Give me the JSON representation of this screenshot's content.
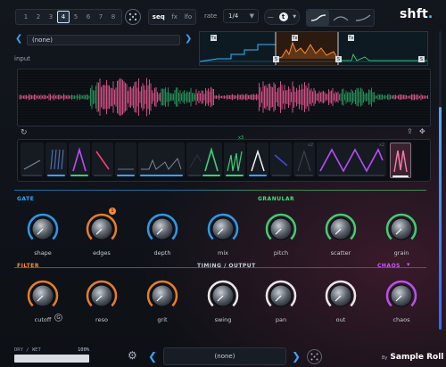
{
  "header": {
    "slots": [
      "1",
      "2",
      "3",
      "4",
      "5",
      "6",
      "7",
      "8"
    ],
    "active_slot": 3,
    "tabs": [
      {
        "label": "seq",
        "selected": true
      },
      {
        "label": "fx",
        "selected": false
      },
      {
        "label": "lfo",
        "selected": false
      }
    ],
    "rate_label": "rate",
    "rate_value": "1/4",
    "trigger_badge": "t",
    "logo_text": "shft",
    "logo_dot": "."
  },
  "preset_top": {
    "value": "(none)"
  },
  "input_label": "input",
  "envelope_tags": [
    "Tx",
    "Tx",
    "Tx"
  ],
  "envelope_markers": [
    "S",
    "S",
    "S"
  ],
  "seq": {
    "badge_a": "x2",
    "badge_b": "x3",
    "badge_c": "x2",
    "badge_d": "x2",
    "colors": [
      "#37d17a",
      "#3ea0ff",
      "#ff3b6e",
      "#b84dff",
      "#ffffff"
    ]
  },
  "sections": {
    "gate": "GATE",
    "granular": "GRANULAR",
    "filter": "FILTER",
    "timing_output": "TIMING / OUTPUT",
    "chaos": "CHAOS"
  },
  "knobs_row1": [
    {
      "label": "shape",
      "color": "#2fa8ff"
    },
    {
      "label": "edges",
      "color": "#ff8a2a",
      "badge": "1"
    },
    {
      "label": "depth",
      "color": "#2fa8ff"
    },
    {
      "label": "mix",
      "color": "#2fa8ff"
    },
    {
      "label": "pitch",
      "color": "#3fe27a"
    },
    {
      "label": "scatter",
      "color": "#3fe27a"
    },
    {
      "label": "grain",
      "color": "#3fe27a"
    }
  ],
  "knobs_row2": [
    {
      "label": "cutoff",
      "color": "#ff8a2a",
      "chip": "G"
    },
    {
      "label": "reso",
      "color": "#ff8a2a"
    },
    {
      "label": "grit",
      "color": "#ff8a2a"
    },
    {
      "label": "swing",
      "color": "#ffffff"
    },
    {
      "label": "pan",
      "color": "#ffffff"
    },
    {
      "label": "out",
      "color": "#ffffff"
    },
    {
      "label": "chaos",
      "color": "#c35bff"
    }
  ],
  "bottom": {
    "dry_wet_label": "DRY / WET",
    "dry_wet_pct": "100%",
    "dry_wet_value": 1.0,
    "preset_value": "(none)",
    "brand_by": "By",
    "brand_name": "Sample Roll"
  }
}
